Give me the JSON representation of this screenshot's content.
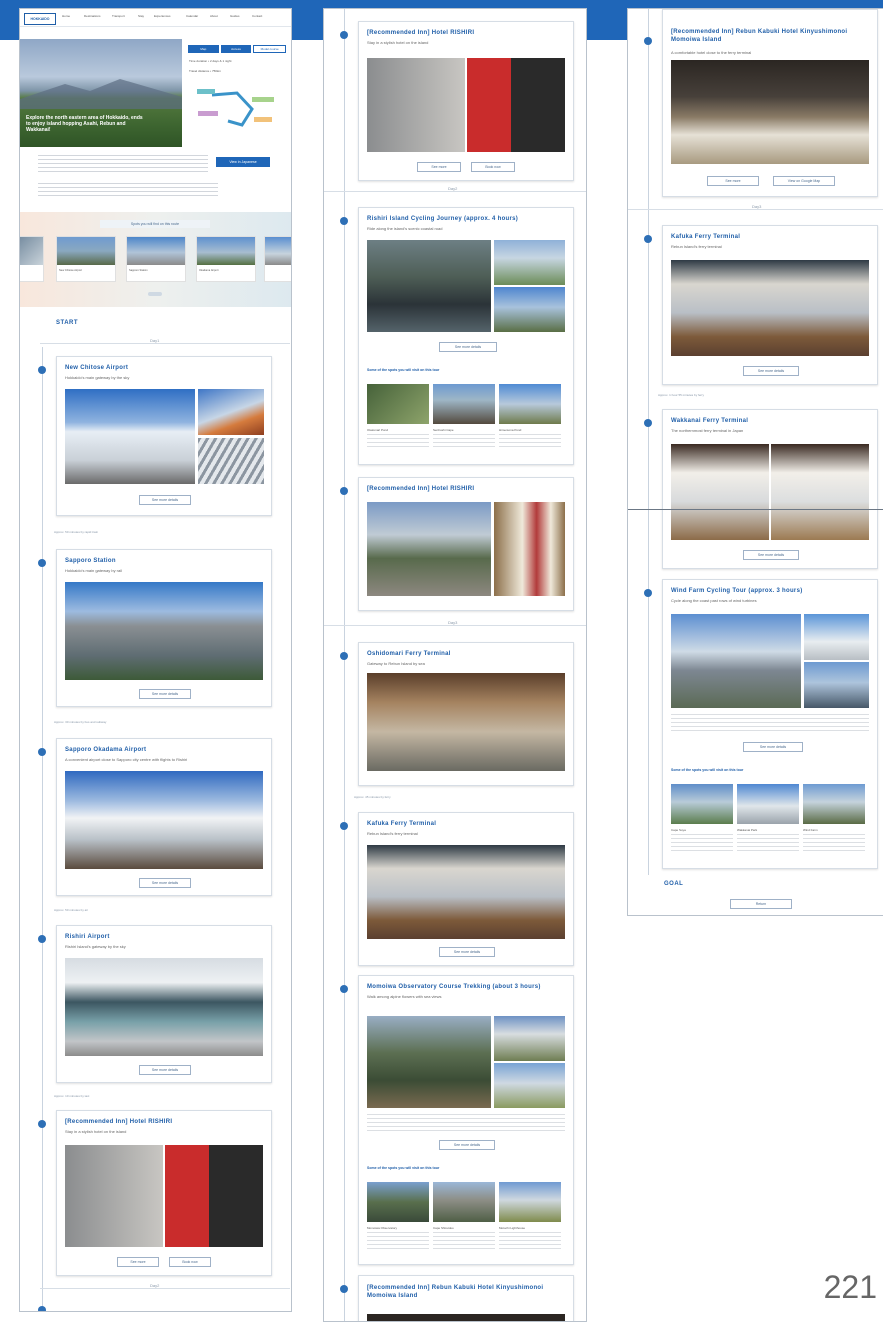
{
  "page_number": "221",
  "col1": {
    "logo": "HOKKAIDO",
    "nav": [
      "Home",
      "Destinations",
      "Transport",
      "Stay",
      "Experiences",
      "Calendar",
      "About",
      "Guides",
      "Contact"
    ],
    "hero_caption": "Explore the north eastern area of Hokkaido, ends to enjoy island hopping Asahi, Rebun and Wakkanai!",
    "hero_links": [
      "Map",
      "Access",
      "Model course"
    ],
    "hero_info_1": "Time duration • 2 days & 1 night",
    "hero_info_2": "Travel distance • 750km",
    "intro_button": "View in Japanese",
    "band_title": "Spots you will find on this route",
    "band_items": [
      "New Chitose Airport",
      "Sapporo Station",
      "Okadama Airport",
      "Rishiri Airport",
      "Wakkanai"
    ],
    "start_label": "START",
    "day_label": "Day1",
    "stops": [
      {
        "title": "New Chitose Airport",
        "subtitle": "Hokkaido's main gateway by the sky",
        "button": "See more details"
      },
      {
        "title": "Sapporo Station",
        "subtitle": "Hokkaido's main gateway by rail",
        "button": "See more details"
      },
      {
        "title": "Sapporo Okadama Airport",
        "subtitle": "A convenient airport close to Sapporo city centre with flights to Rishiri",
        "button": "See more details"
      },
      {
        "title": "Rishiri Airport",
        "subtitle": "Rishiri Island's gateway by the sky",
        "button": "See more details"
      },
      {
        "title": "[Recommended Inn] Hotel RISHIRI",
        "subtitle": "Stay in a stylish hotel on the island",
        "buttons": [
          "See more",
          "Book now"
        ]
      }
    ],
    "notes": [
      "Approx. 50 minutes by rapid train",
      "Approx. 30 minutes by bus and subway",
      "Approx. 50 minutes by air",
      "Approx. 10 minutes by taxi"
    ],
    "day2_label": "Day2"
  },
  "col2": {
    "stops": [
      {
        "title": "[Recommended Inn] Hotel RISHIRI",
        "subtitle": "Stay in a stylish hotel on the island",
        "buttons": [
          "See more",
          "Book now"
        ]
      },
      {
        "title": "Rishiri Island Cycling Journey (approx. 4 hours)",
        "subtitle": "Ride along the island's scenic coastal road",
        "button": "See more details",
        "spots_title": "Some of the spots you will visit on this tour",
        "spots": [
          "Otatomari Pond",
          "Senhoshi Cape",
          "Himenuma Pond"
        ]
      },
      {
        "title": "[Recommended Inn] Hotel RISHIRI",
        "subtitle": "",
        "button": ""
      },
      {
        "title": "Oshidomari Ferry Terminal",
        "subtitle": "Gateway to Rebun Island by sea",
        "button": "See more details"
      },
      {
        "title": "Kafuka Ferry Terminal",
        "subtitle": "Rebun Island's ferry terminal",
        "button": "See more details"
      },
      {
        "title": "Momoiwa Observatory Course Trekking (about 3 hours)",
        "subtitle": "Walk among alpine flowers with sea views",
        "button": "See more details",
        "spots_title": "Some of the spots you will visit on this tour",
        "spots": [
          "Momoiwa Observatory",
          "Cape Shiretoko",
          "Motochi Lighthouse"
        ]
      },
      {
        "title": "[Recommended Inn] Rebun Kabuki Hotel Kinyushimonoi Momoiwa Island",
        "subtitle": "Stay on Rebun Island",
        "button": ""
      }
    ],
    "day_labels": [
      "Day2",
      "Day3"
    ],
    "note": "Approx. 45 minutes by ferry"
  },
  "col3": {
    "stops": [
      {
        "title": "[Recommended Inn] Rebun Kabuki Hotel Kinyushimonoi Momoiwa Island",
        "subtitle": "A comfortable hotel close to the ferry terminal",
        "buttons": [
          "See more",
          "View on Google Map"
        ]
      },
      {
        "title": "Kafuka Ferry Terminal",
        "subtitle": "Rebun Island's ferry terminal",
        "button": "See more details"
      },
      {
        "title": "Wakkanai Ferry Terminal",
        "subtitle": "The northernmost ferry terminal in Japan",
        "button": "See more details"
      },
      {
        "title": "Wind Farm Cycling Tour (approx. 3 hours)",
        "subtitle": "Cycle along the coast past rows of wind turbines",
        "button": "See more details",
        "spots_title": "Some of the spots you will visit on this tour",
        "spots": [
          "Cape Soya",
          "Wakkanai Park",
          "Wind Farm"
        ]
      }
    ],
    "day_label": "Day3",
    "note": "Approx. 1 hour 55 minutes by ferry",
    "goal_label": "GOAL",
    "goal_button": "Return"
  }
}
